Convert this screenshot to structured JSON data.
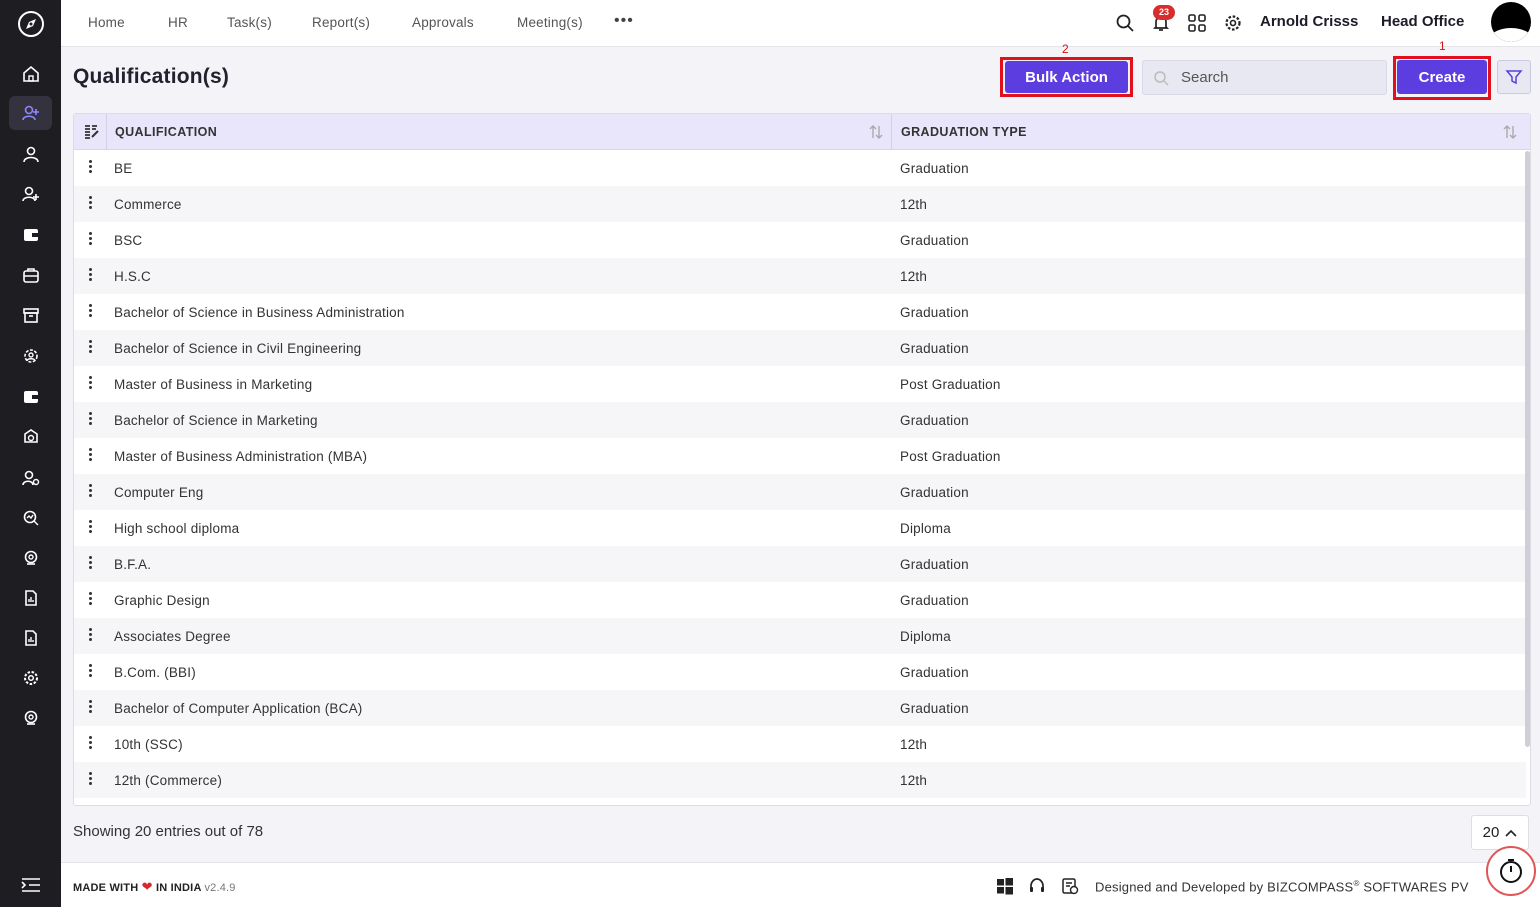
{
  "nav": {
    "items": [
      {
        "label": "Home"
      },
      {
        "label": "HR"
      },
      {
        "label": "Task(s)"
      },
      {
        "label": "Report(s)"
      },
      {
        "label": "Approvals"
      },
      {
        "label": "Meeting(s)"
      }
    ],
    "more": "•••",
    "notification_count": "23",
    "user_name": "Arnold Crisss",
    "office": "Head Office"
  },
  "page": {
    "title": "Qualification(s)",
    "bulk_action_label": "Bulk Action",
    "create_label": "Create",
    "search_placeholder": "Search",
    "annotation_bulk": "2",
    "annotation_create": "1"
  },
  "table": {
    "columns": [
      "QUALIFICATION",
      "GRADUATION TYPE"
    ],
    "rows": [
      {
        "qualification": "BE",
        "type": "Graduation"
      },
      {
        "qualification": "Commerce",
        "type": "12th"
      },
      {
        "qualification": "BSC",
        "type": "Graduation"
      },
      {
        "qualification": "H.S.C",
        "type": "12th"
      },
      {
        "qualification": "Bachelor of Science in Business Administration",
        "type": "Graduation"
      },
      {
        "qualification": "Bachelor of Science in Civil Engineering",
        "type": "Graduation"
      },
      {
        "qualification": "Master of Business in Marketing",
        "type": "Post Graduation"
      },
      {
        "qualification": "Bachelor of Science in Marketing",
        "type": "Graduation"
      },
      {
        "qualification": "Master of Business Administration (MBA)",
        "type": "Post Graduation"
      },
      {
        "qualification": "Computer Eng",
        "type": "Graduation"
      },
      {
        "qualification": "High school diploma",
        "type": "Diploma"
      },
      {
        "qualification": "B.F.A.",
        "type": "Graduation"
      },
      {
        "qualification": "Graphic Design",
        "type": "Graduation"
      },
      {
        "qualification": "Associates Degree",
        "type": "Diploma"
      },
      {
        "qualification": "B.Com. (BBI)",
        "type": "Graduation"
      },
      {
        "qualification": "Bachelor of Computer Application (BCA)",
        "type": "Graduation"
      },
      {
        "qualification": "10th (SSC)",
        "type": "12th"
      },
      {
        "qualification": "12th (Commerce)",
        "type": "12th"
      }
    ]
  },
  "footer": {
    "showing": "Showing 20 entries out of 78",
    "page_size": "20",
    "made_with": "MADE WITH",
    "in_india": "IN INDIA",
    "version": "v2.4.9",
    "designed_by": "Designed and Developed by",
    "company": "BIZCOMPASS",
    "company_suffix": "SOFTWARES PV"
  },
  "colors": {
    "accent": "#5b3de0",
    "sidebar": "#1d1d22",
    "annotation": "#e0101c",
    "header_bg": "#e9e6fb"
  },
  "icons": [
    "compass-logo-icon",
    "home-icon",
    "user-plus-icon",
    "user-icon",
    "user-add-icon",
    "wallet-icon",
    "briefcase-icon",
    "archive-icon",
    "people-gear-icon",
    "wallet-alt-icon",
    "badge-icon",
    "user-settings-icon",
    "search-analytics-icon",
    "support-icon",
    "report-icon",
    "report-alt-icon",
    "settings-icon",
    "headset-icon",
    "menu-collapse-icon",
    "search-icon",
    "bell-icon",
    "apps-grid-icon",
    "gear-icon",
    "filter-icon",
    "sort-icon",
    "windows-icon",
    "support-headset-icon",
    "checklist-icon",
    "timer-icon"
  ]
}
